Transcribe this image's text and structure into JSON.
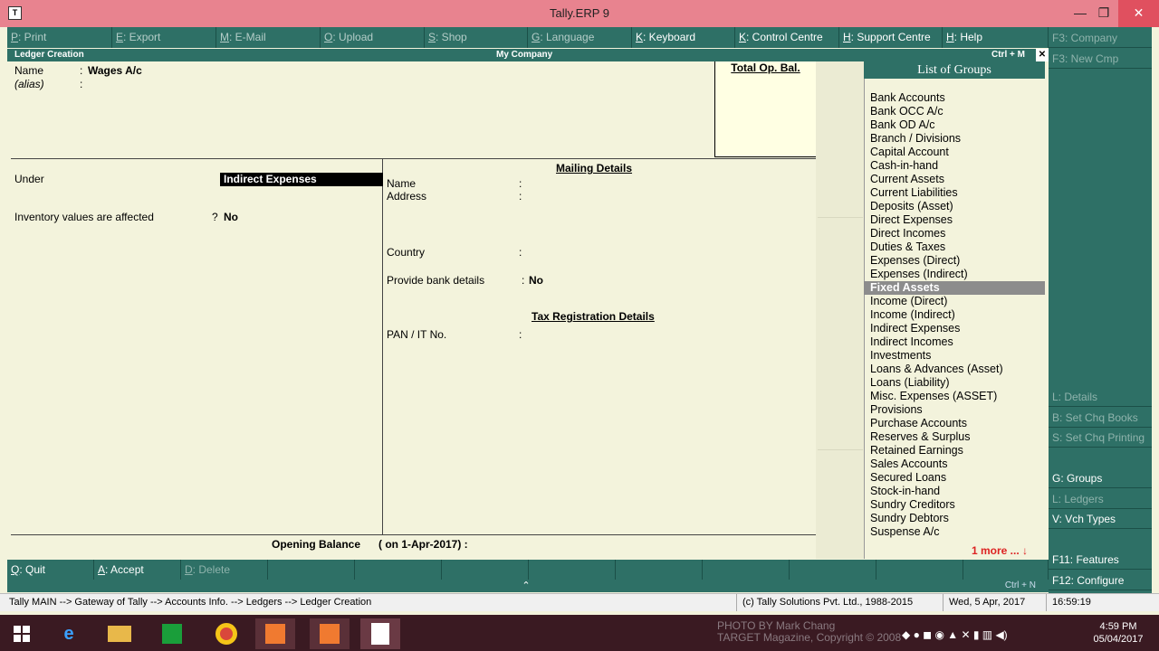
{
  "window": {
    "title": "Tally.ERP 9",
    "minimize": "—",
    "maximize": "❐",
    "close": "✕"
  },
  "topbar": [
    {
      "key": "P",
      "label": ": Print",
      "w": 116,
      "on": false
    },
    {
      "key": "E",
      "label": ": Export",
      "w": 115,
      "on": false
    },
    {
      "key": "M",
      "label": ": E-Mail",
      "w": 115,
      "on": false
    },
    {
      "key": "O",
      "label": ": Upload",
      "w": 115,
      "on": false
    },
    {
      "key": "S",
      "label": ": Shop",
      "w": 114,
      "on": false
    },
    {
      "key": "G",
      "label": ": Language",
      "w": 115,
      "on": false
    },
    {
      "key": "K",
      "label": ": Keyboard",
      "w": 114,
      "on": true
    },
    {
      "key": "K",
      "label": ": Control Centre",
      "w": 115,
      "on": true
    },
    {
      "key": "H",
      "label": ": Support Centre",
      "w": 114,
      "on": true
    },
    {
      "key": "H",
      "label": ": Help",
      "w": 117,
      "on": true
    }
  ],
  "right_panel_top": [
    {
      "text": "F3: Company",
      "off": true
    },
    {
      "text": "F3: New Cmp",
      "off": true
    }
  ],
  "right_panel_mid": [
    {
      "text": "L: Details",
      "off": true
    },
    {
      "text": "B: Set Chq Books",
      "off": true
    },
    {
      "text": "S: Set Chq Printing",
      "off": true
    }
  ],
  "right_panel_bot": [
    {
      "text": "G: Groups",
      "off": false
    },
    {
      "text": "L: Ledgers",
      "off": true
    },
    {
      "text": "V: Vch Types",
      "off": false
    }
  ],
  "right_panel_fn": [
    {
      "text": "F11: Features"
    },
    {
      "text": "F12: Configure"
    }
  ],
  "header": {
    "left": "Ledger Creation",
    "center": "My Company",
    "right": "Ctrl + M",
    "close": "✕"
  },
  "form": {
    "name_label": "Name",
    "name_value": "Wages A/c",
    "alias_label": "(alias)",
    "colon": ":",
    "total_op_bal": "Total Op. Bal.",
    "under_label": "Under",
    "under_value": "Indirect Expenses",
    "inventory_label": "Inventory values are affected",
    "inventory_q": "?",
    "inventory_value": "No",
    "mailing_title": "Mailing Details",
    "mail_name": "Name",
    "mail_address": "Address",
    "country": "Country",
    "bank_label": "Provide bank details",
    "bank_value": "No",
    "tax_title": "Tax Registration Details",
    "pan_label": "PAN / IT No.",
    "opening_balance": "Opening Balance",
    "opening_date": "( on 1-Apr-2017) :"
  },
  "groups": {
    "title": "List of Groups",
    "items": [
      "Bank Accounts",
      "Bank OCC A/c",
      "Bank OD A/c",
      "Branch / Divisions",
      "Capital Account",
      "Cash-in-hand",
      "Current Assets",
      "Current Liabilities",
      "Deposits (Asset)",
      "Direct Expenses",
      "Direct Incomes",
      "Duties & Taxes",
      "Expenses (Direct)",
      "Expenses (Indirect)",
      "Fixed Assets",
      "Income (Direct)",
      "Income (Indirect)",
      "Indirect Expenses",
      "Indirect Incomes",
      "Investments",
      "Loans & Advances (Asset)",
      "Loans (Liability)",
      "Misc. Expenses (ASSET)",
      "Provisions",
      "Purchase Accounts",
      "Reserves & Surplus",
      "Retained Earnings",
      "Sales Accounts",
      "Secured Loans",
      "Stock-in-hand",
      "Sundry Creditors",
      "Sundry Debtors",
      "Suspense A/c"
    ],
    "selected_index": 14,
    "more": "1 more ... ↓"
  },
  "bottombar": [
    {
      "key": "Q",
      "label": ": Quit",
      "off": false
    },
    {
      "key": "A",
      "label": ": Accept",
      "off": false
    },
    {
      "key": "D",
      "label": ": Delete",
      "off": true
    }
  ],
  "bottom_ctrl": "Ctrl + N",
  "status": {
    "path": "Tally MAIN --> Gateway of Tally --> Accounts Info. --> Ledgers --> Ledger Creation",
    "copyright": "(c) Tally Solutions Pvt. Ltd., 1988-2015",
    "date": "Wed, 5 Apr, 2017",
    "time": "16:59:19"
  },
  "taskbar": {
    "photo_line1": "PHOTO BY Mark Chang",
    "photo_line2": "TARGET Magazine, Copyright © 2008",
    "clock_time": "4:59 PM",
    "clock_date": "05/04/2017"
  }
}
